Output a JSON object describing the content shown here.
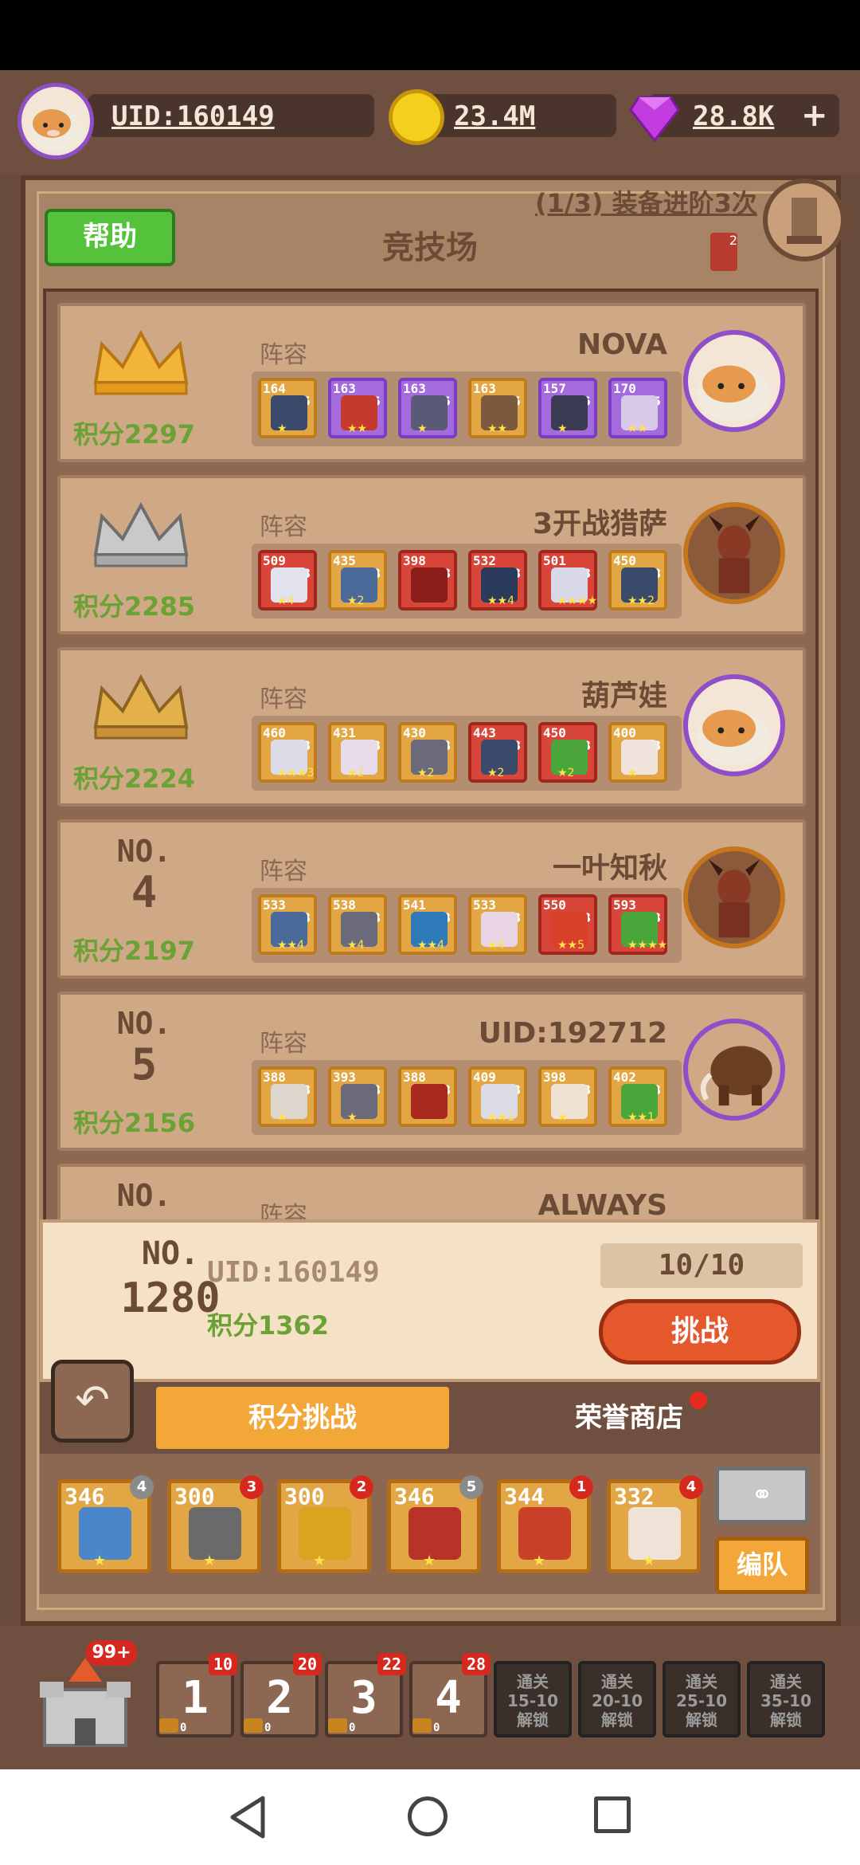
{
  "topbar": {
    "uid": "UID:160149",
    "gold": "23.4M",
    "gems": "28.8K",
    "plus": "+"
  },
  "header": {
    "help": "帮助",
    "title": "竞技场",
    "quest": "(1/3) 装备进阶3次",
    "quest_badge": "2"
  },
  "leaderboard": {
    "lineup_label": "阵容",
    "entries": [
      {
        "rank_label": "",
        "rank_number": "",
        "score": "积分2297",
        "name": "NOVA",
        "heroes": [
          {
            "level": "164",
            "tier": "5",
            "stars": "★"
          },
          {
            "level": "163",
            "tier": "5",
            "stars": "★★"
          },
          {
            "level": "163",
            "tier": "5",
            "stars": "★"
          },
          {
            "level": "163",
            "tier": "5",
            "stars": "★★"
          },
          {
            "level": "157",
            "tier": "5",
            "stars": "★"
          },
          {
            "level": "170",
            "tier": "5",
            "stars": "★★"
          }
        ]
      },
      {
        "rank_label": "",
        "rank_number": "",
        "score": "积分2285",
        "name": "3开战猎萨",
        "heroes": [
          {
            "level": "509",
            "tier": "8",
            "stars": "★4"
          },
          {
            "level": "435",
            "tier": "8",
            "stars": "★2"
          },
          {
            "level": "398",
            "tier": "8",
            "stars": ""
          },
          {
            "level": "532",
            "tier": "8",
            "stars": "★★4"
          },
          {
            "level": "501",
            "tier": "8",
            "stars": "★★★★"
          },
          {
            "level": "450",
            "tier": "8",
            "stars": "★★2"
          }
        ]
      },
      {
        "rank_label": "",
        "rank_number": "",
        "score": "积分2224",
        "name": "葫芦娃",
        "heroes": [
          {
            "level": "460",
            "tier": "8",
            "stars": "★★★3"
          },
          {
            "level": "431",
            "tier": "8",
            "stars": "★2"
          },
          {
            "level": "430",
            "tier": "8",
            "stars": "★2"
          },
          {
            "level": "443",
            "tier": "8",
            "stars": "★2"
          },
          {
            "level": "450",
            "tier": "8",
            "stars": "★2"
          },
          {
            "level": "400",
            "tier": "8",
            "stars": "★"
          }
        ]
      },
      {
        "rank_label": "NO.",
        "rank_number": "4",
        "score": "积分2197",
        "name": "一叶知秋",
        "heroes": [
          {
            "level": "533",
            "tier": "8",
            "stars": "★★4"
          },
          {
            "level": "538",
            "tier": "8",
            "stars": "★4"
          },
          {
            "level": "541",
            "tier": "8",
            "stars": "★★4"
          },
          {
            "level": "533",
            "tier": "8",
            "stars": "★4"
          },
          {
            "level": "550",
            "tier": "8",
            "stars": "★★5"
          },
          {
            "level": "593",
            "tier": "8",
            "stars": "★★★★"
          }
        ]
      },
      {
        "rank_label": "NO.",
        "rank_number": "5",
        "score": "积分2156",
        "name": "UID:192712",
        "heroes": [
          {
            "level": "388",
            "tier": "8",
            "stars": "★"
          },
          {
            "level": "393",
            "tier": "8",
            "stars": "★"
          },
          {
            "level": "388",
            "tier": "8",
            "stars": ""
          },
          {
            "level": "409",
            "tier": "8",
            "stars": "★★1"
          },
          {
            "level": "398",
            "tier": "8",
            "stars": "★"
          },
          {
            "level": "402",
            "tier": "8",
            "stars": "★★1"
          }
        ]
      },
      {
        "rank_label": "NO.",
        "rank_number": "",
        "score": "",
        "name": "ALWAYS",
        "heroes": []
      }
    ]
  },
  "me": {
    "rank_label": "NO.",
    "rank_number": "1280",
    "uid": "UID:160149",
    "score": "积分1362",
    "attempts": "10/10",
    "challenge": "挑战"
  },
  "tabs": {
    "back": "↶",
    "score_challenge": "积分挑战",
    "honor_shop": "荣誉商店"
  },
  "deck": {
    "cards": [
      {
        "power": "346",
        "badge": "4",
        "stars": "★"
      },
      {
        "power": "300",
        "badge": "3",
        "stars": "★"
      },
      {
        "power": "300",
        "badge": "2",
        "stars": "★"
      },
      {
        "power": "346",
        "badge": "5",
        "stars": "★"
      },
      {
        "power": "344",
        "badge": "1",
        "stars": "★"
      },
      {
        "power": "332",
        "badge": "4",
        "stars": "★"
      }
    ],
    "team_button": "编队"
  },
  "stages": {
    "castle_badge": "99+",
    "unlocked": [
      {
        "num": "1",
        "badge": "10",
        "chest": "0"
      },
      {
        "num": "2",
        "badge": "20",
        "chest": "0"
      },
      {
        "num": "3",
        "badge": "22",
        "chest": "0"
      },
      {
        "num": "4",
        "badge": "28",
        "chest": "0"
      }
    ],
    "locked": [
      {
        "line1": "通关",
        "line2": "15-10",
        "line3": "解锁"
      },
      {
        "line1": "通关",
        "line2": "20-10",
        "line3": "解锁"
      },
      {
        "line1": "通关",
        "line2": "25-10",
        "line3": "解锁"
      },
      {
        "line1": "通关",
        "line2": "35-10",
        "line3": "解锁"
      }
    ]
  },
  "colors": {
    "board": "#a88467",
    "card": "#cfa885",
    "score_green": "#6ba235",
    "challenge_red": "#e4582c",
    "tab_orange": "#f3a738"
  }
}
